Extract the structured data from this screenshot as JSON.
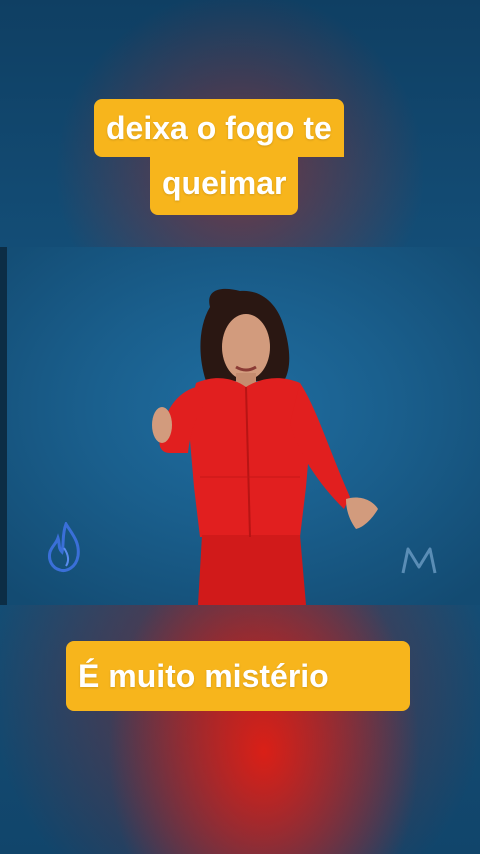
{
  "captions": {
    "top_line1": "deixa o fogo te",
    "top_line2": "queimar",
    "bottom": "É muito mistério"
  },
  "icons": {
    "left_logo": "flame-icon",
    "right_logo": "m-logo-icon"
  },
  "colors": {
    "caption_bg": "#f7b51c",
    "caption_text": "#ffffff",
    "video_bg": "#1a5f8d",
    "outfit": "#e11f1f"
  }
}
